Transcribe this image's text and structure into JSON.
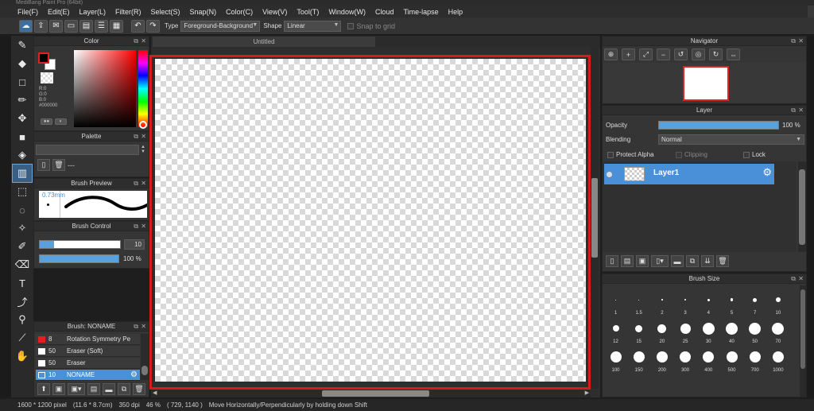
{
  "window": {
    "title": "MediBang Paint Pro (64bit)"
  },
  "menu": [
    "File(F)",
    "Edit(E)",
    "Layer(L)",
    "Filter(R)",
    "Select(S)",
    "Snap(N)",
    "Color(C)",
    "View(V)",
    "Tool(T)",
    "Window(W)",
    "Cloud",
    "Time-lapse",
    "Help"
  ],
  "toolbar": {
    "type_label": "Type",
    "type_value": "Foreground-Background",
    "shape_label": "Shape",
    "shape_value": "Linear",
    "snap_label": "Snap to grid"
  },
  "color_panel": {
    "title": "Color",
    "r": "R:0",
    "g": "G:0",
    "b": "B:0",
    "hex": "#000000",
    "foreground": "#000000",
    "background": "#ffffff"
  },
  "palette_panel": {
    "title": "Palette",
    "dashes": "---"
  },
  "brush_preview": {
    "title": "Brush Preview",
    "size": "0.73mm"
  },
  "brush_control": {
    "title": "Brush Control",
    "size_value": "10",
    "opacity_value": "100 %",
    "size_fraction": 0.18,
    "opacity_fraction": 1.0
  },
  "brush_list": {
    "title": "Brush: NONAME",
    "items": [
      {
        "size": "8",
        "name": "Rotation Symmetry Pe",
        "color": "#e02020"
      },
      {
        "size": "50",
        "name": "Eraser (Soft)",
        "color": "#ffffff"
      },
      {
        "size": "50",
        "name": "Eraser",
        "color": "#ffffff"
      },
      {
        "size": "10",
        "name": "NONAME",
        "color": "#ffffff",
        "selected": true
      }
    ]
  },
  "canvas": {
    "tab": "Untitled"
  },
  "navigator": {
    "title": "Navigator"
  },
  "layer_panel": {
    "title": "Layer",
    "opacity_label": "Opacity",
    "opacity_value": "100 %",
    "blending_label": "Blending",
    "blending_value": "Normal",
    "protect_alpha": "Protect Alpha",
    "clipping": "Clipping",
    "lock": "Lock",
    "layer_name": "Layer1"
  },
  "brush_size": {
    "title": "Brush Size",
    "sizes": [
      "1",
      "1.5",
      "2",
      "3",
      "4",
      "5",
      "7",
      "10",
      "12",
      "15",
      "20",
      "25",
      "30",
      "40",
      "50",
      "70",
      "100",
      "150",
      "200",
      "300",
      "400",
      "500",
      "700",
      "1000"
    ]
  },
  "status": {
    "dimensions": "1600 * 1200 pixel",
    "physical": "(11.6 * 8.7cm)",
    "dpi": "350 dpi",
    "zoom": "46 %",
    "coords": "( 729, 1140 )",
    "hint": "Move Horizontally/Perpendicularly by holding down Shift"
  },
  "colors": {
    "accent": "#4a90d9",
    "canvas_border": "#d9191c"
  }
}
